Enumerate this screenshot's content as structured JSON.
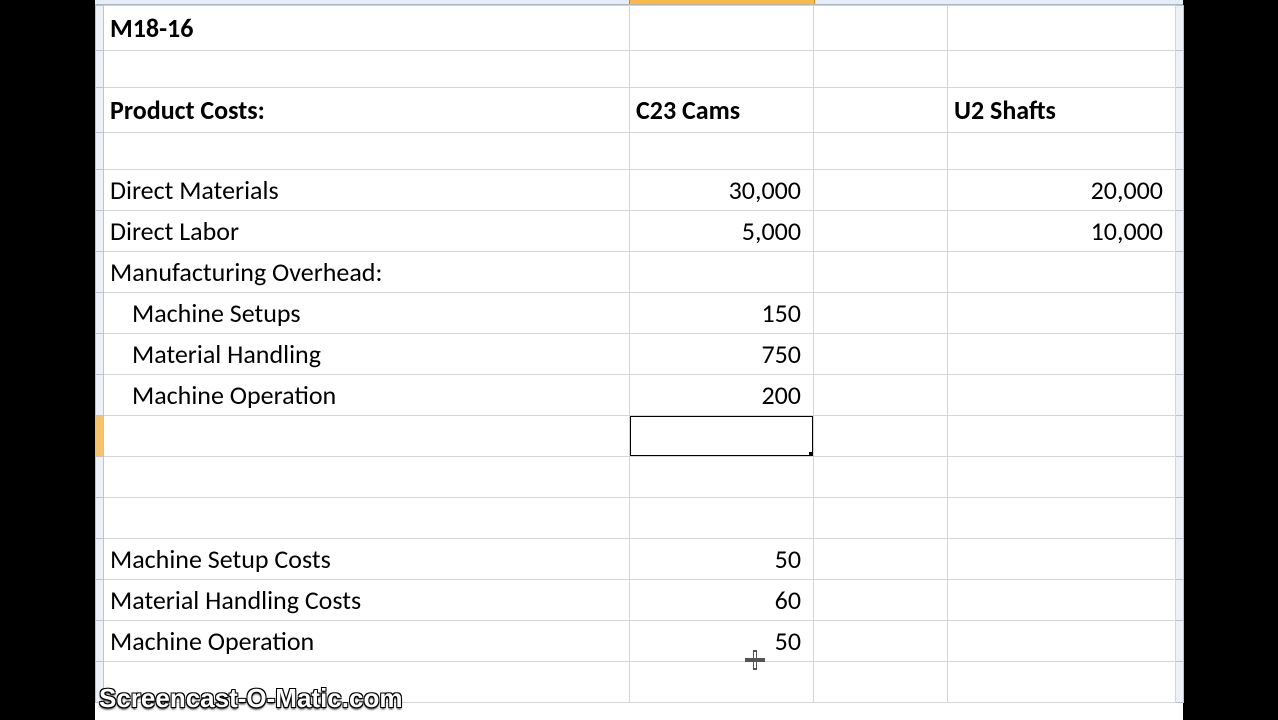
{
  "title_row": "M18-16",
  "section_header": "Product Costs:",
  "col_headers": {
    "b": "C23 Cams",
    "d": "U2 Shafts"
  },
  "rows": {
    "direct_materials": {
      "label": "Direct Materials",
      "b": "30,000",
      "d": "20,000"
    },
    "direct_labor": {
      "label": "Direct Labor",
      "b": "5,000",
      "d": "10,000"
    },
    "mfg_overhead": {
      "label": "Manufacturing Overhead:"
    },
    "machine_setups": {
      "label": "Machine Setups",
      "b": "150"
    },
    "material_handling": {
      "label": "Material Handling",
      "b": "750"
    },
    "machine_operation": {
      "label": "Machine Operation",
      "b": "200"
    },
    "machine_setup_costs": {
      "label": "Machine Setup Costs",
      "b": "50"
    },
    "material_handling_costs": {
      "label": "Material Handling Costs",
      "b": "60"
    },
    "machine_operation2": {
      "label": "Machine Operation",
      "b": "50"
    }
  },
  "watermark": "Screencast-O-Matic.com"
}
